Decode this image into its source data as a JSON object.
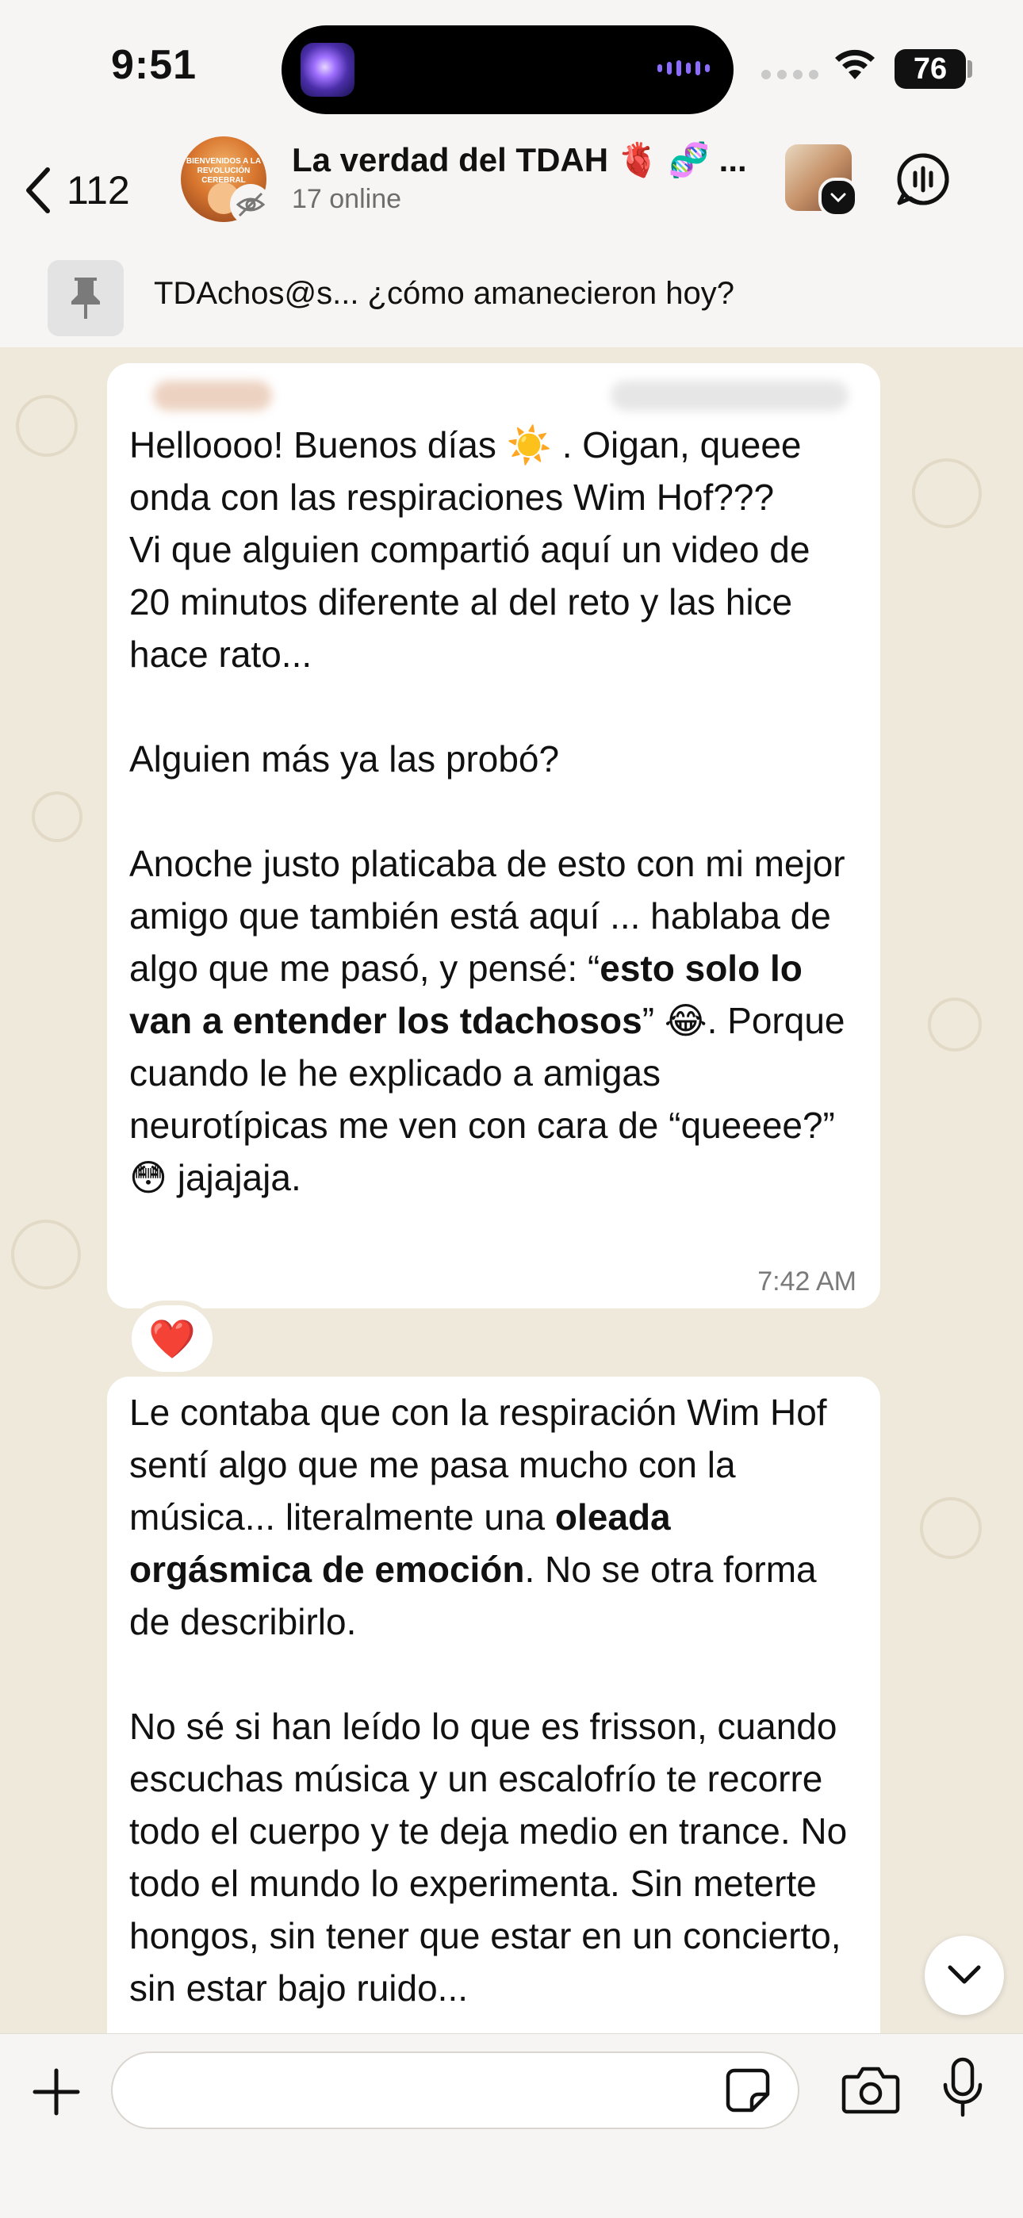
{
  "status": {
    "time": "9:51",
    "battery": "76"
  },
  "header": {
    "back_count": "112",
    "group_name": "La verdad del TDAH 🫀 🧬 ...",
    "subtitle": "17 online",
    "avatar_text": "BIENVENIDOS A LA REVOLUCIÓN CEREBRAL"
  },
  "pinned": {
    "text": "TDAchos@s... ¿cómo amanecieron hoy?"
  },
  "messages": [
    {
      "para1": "Helloooo! Buenos días ☀️ . Oigan, queee onda con las respiraciones Wim Hof???\nVi que alguien compartió aquí un video de 20 minutos diferente al del reto y las hice hace rato...\n\nAlguien más ya las probó?\n\nAnoche justo platicaba de esto con mi mejor amigo que también está aquí ... hablaba de algo que me pasó, y pensé: “",
      "bold1": "esto solo lo van a entender los tdachosos",
      "para2": "” 😂. Porque cuando le he explicado a amigas neurotípicas me ven con cara de “queeee?” 😳 jajajaja.",
      "time": "7:42 AM",
      "reaction": "❤️"
    },
    {
      "para1": "Le contaba que con la respiración Wim Hof sentí algo que me pasa mucho con la música... literalmente una ",
      "bold1": "oleada orgásmica de emoción",
      "para2": ". No se otra forma de describirlo.\n\nNo sé si han leído lo que es frisson, cuando escuchas música y un escalofrío te recorre todo el cuerpo y te deja medio en trance. No todo el mundo lo experimenta. Sin meterte hongos, sin tener que estar en un concierto, sin estar bajo ruido..."
    }
  ],
  "composer": {
    "placeholder": ""
  }
}
